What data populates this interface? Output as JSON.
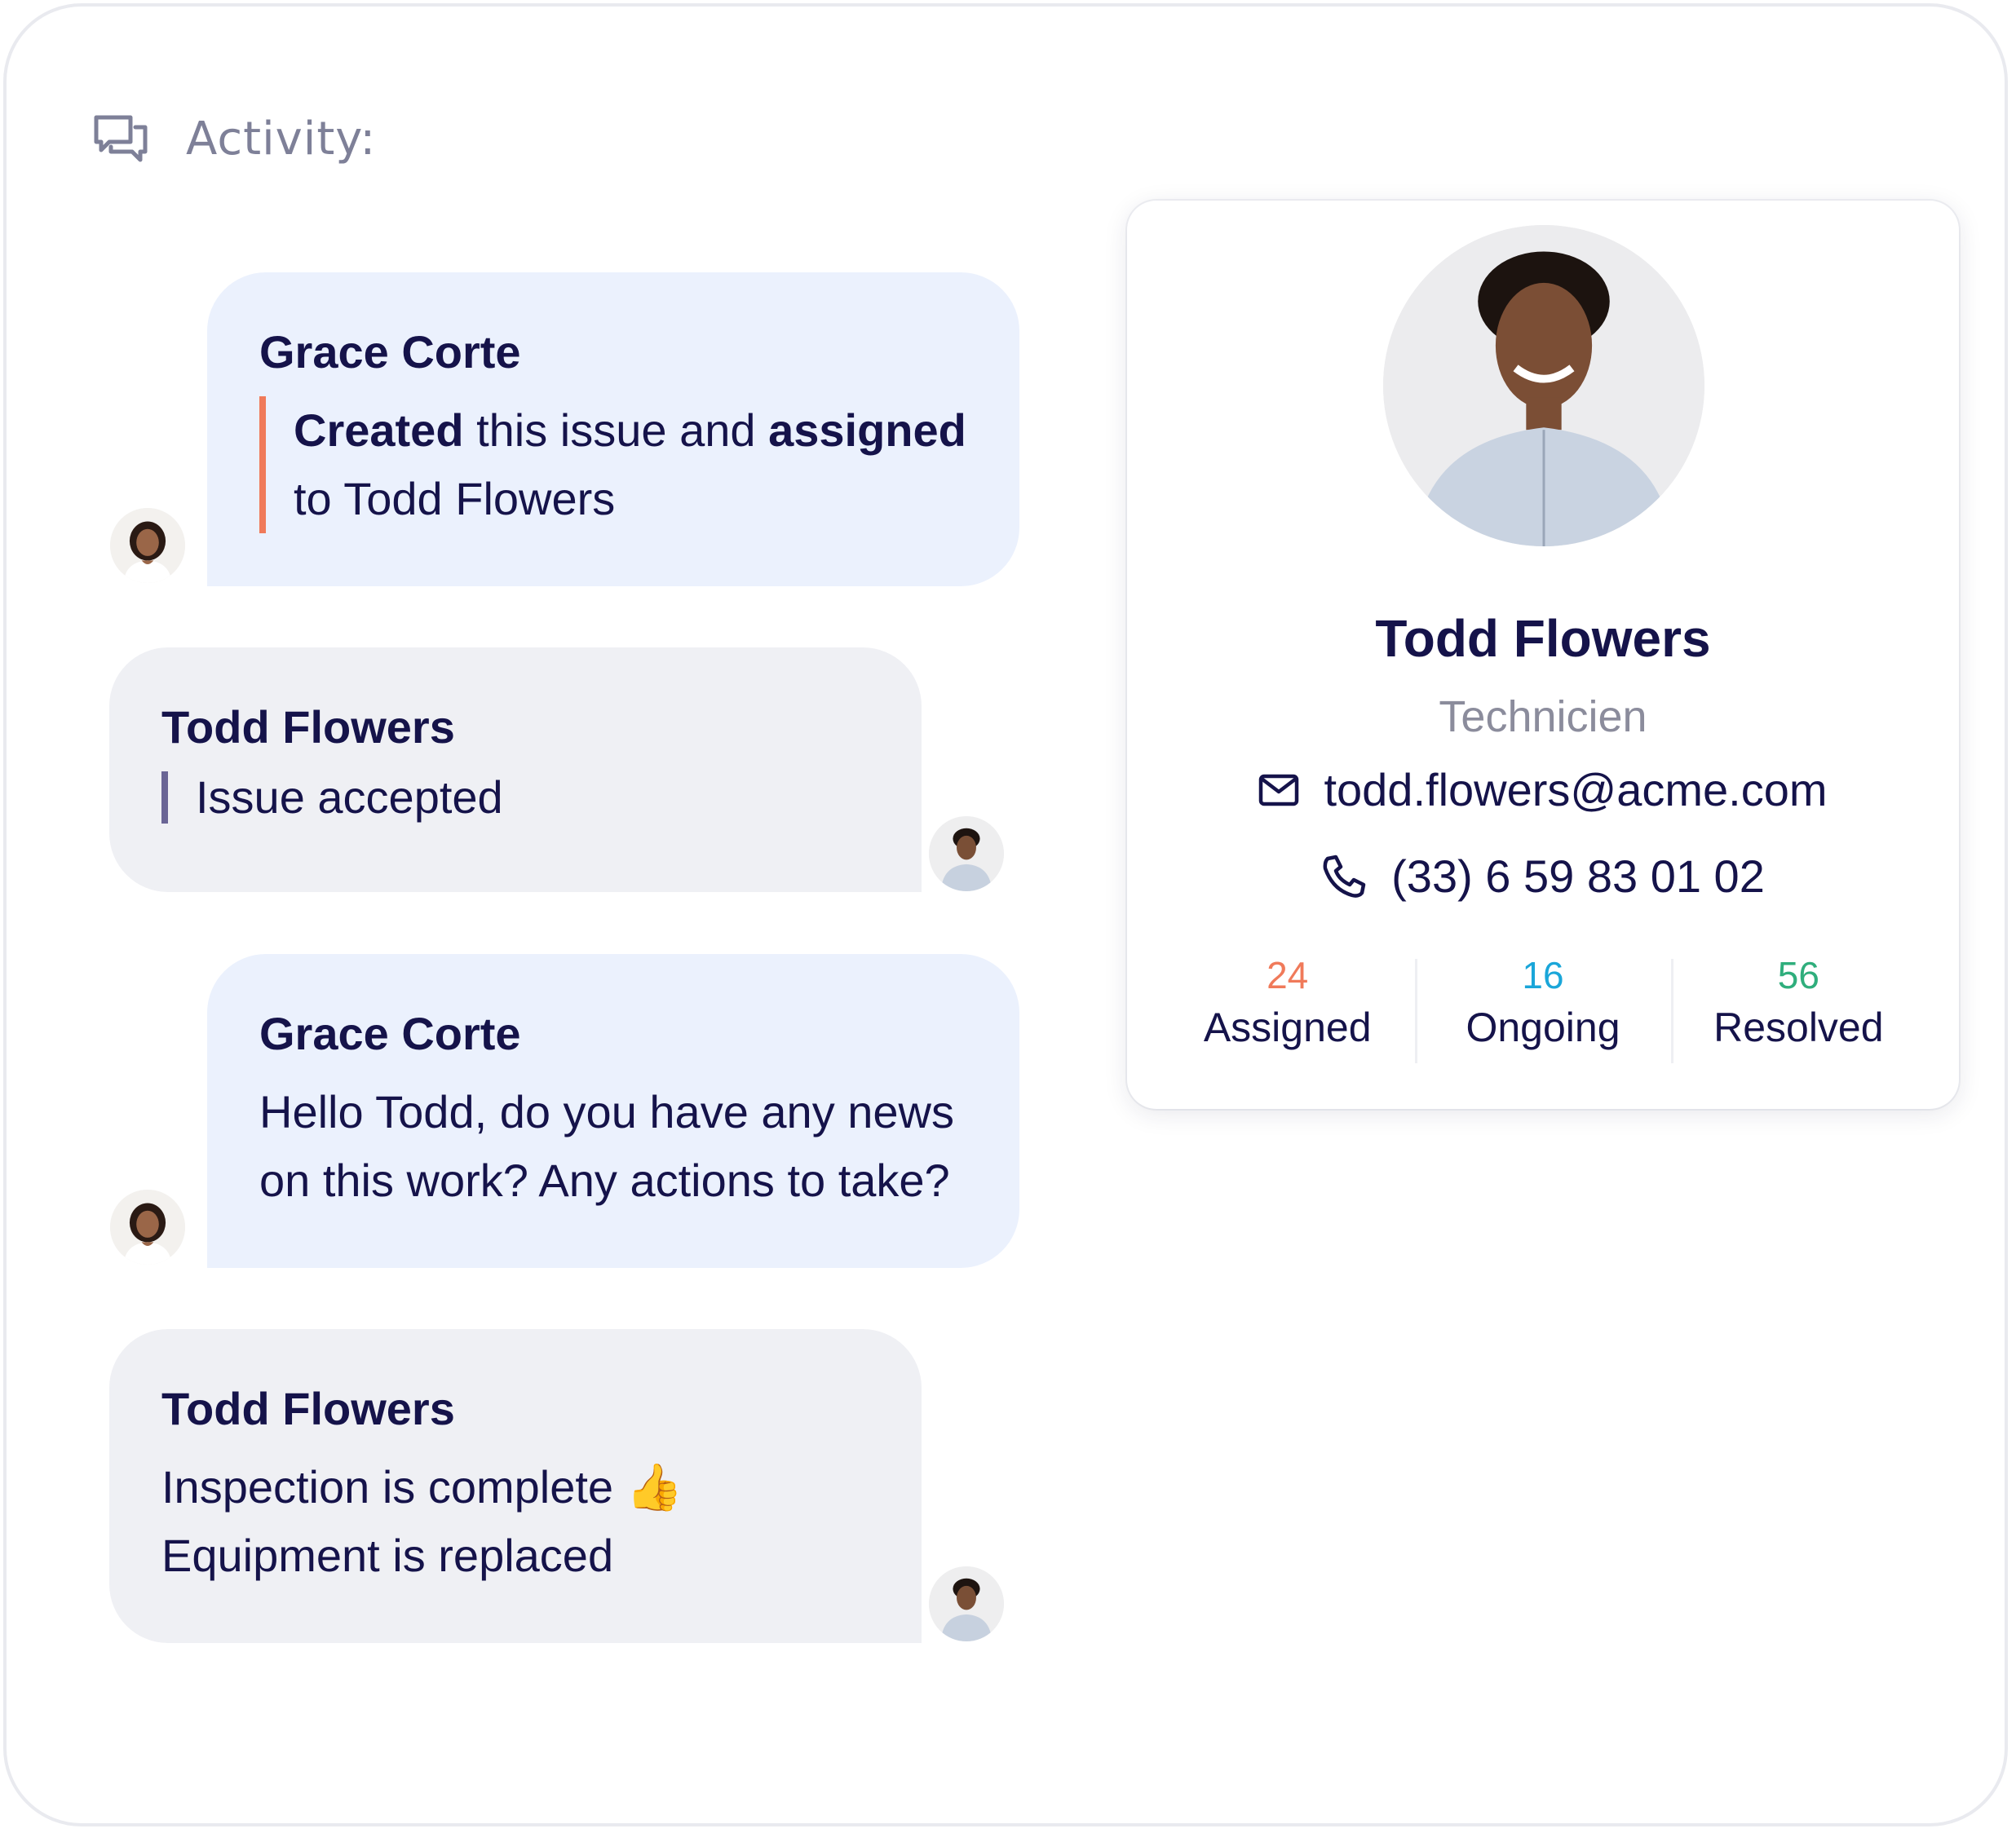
{
  "header": {
    "title": "Activity:",
    "icon": "chat-bubbles-icon"
  },
  "messages": [
    {
      "author": "Grace Corte",
      "style": "quote-orange",
      "parts": [
        "Created",
        " this issue and ",
        "assigned",
        "to Todd Flowers"
      ]
    },
    {
      "author": "Todd Flowers",
      "style": "quote-purple",
      "text": "Issue accepted"
    },
    {
      "author": "Grace Corte",
      "style": "plain",
      "line1": "Hello Todd, do you have any news",
      "line2": "on this work? Any actions to take?"
    },
    {
      "author": "Todd Flowers",
      "style": "plain",
      "line1": "Inspection is complete",
      "emoji": "👍",
      "line2": "Equipment is replaced"
    }
  ],
  "profile": {
    "name": "Todd Flowers",
    "role": "Technicien",
    "email": "todd.flowers@acme.com",
    "phone": "(33) 6 59 83 01 02",
    "stats": [
      {
        "value": "24",
        "label": "Assigned",
        "color": "#f07a5a"
      },
      {
        "value": "16",
        "label": "Ongoing",
        "color": "#1aa6d9"
      },
      {
        "value": "56",
        "label": "Resolved",
        "color": "#2fae7c"
      }
    ]
  },
  "colors": {
    "accent_orange": "#f07a5a",
    "accent_purple": "#6a6595",
    "bubble_blue": "#ebf1fd",
    "bubble_gray": "#eff0f4",
    "text_dark": "#15134a"
  }
}
